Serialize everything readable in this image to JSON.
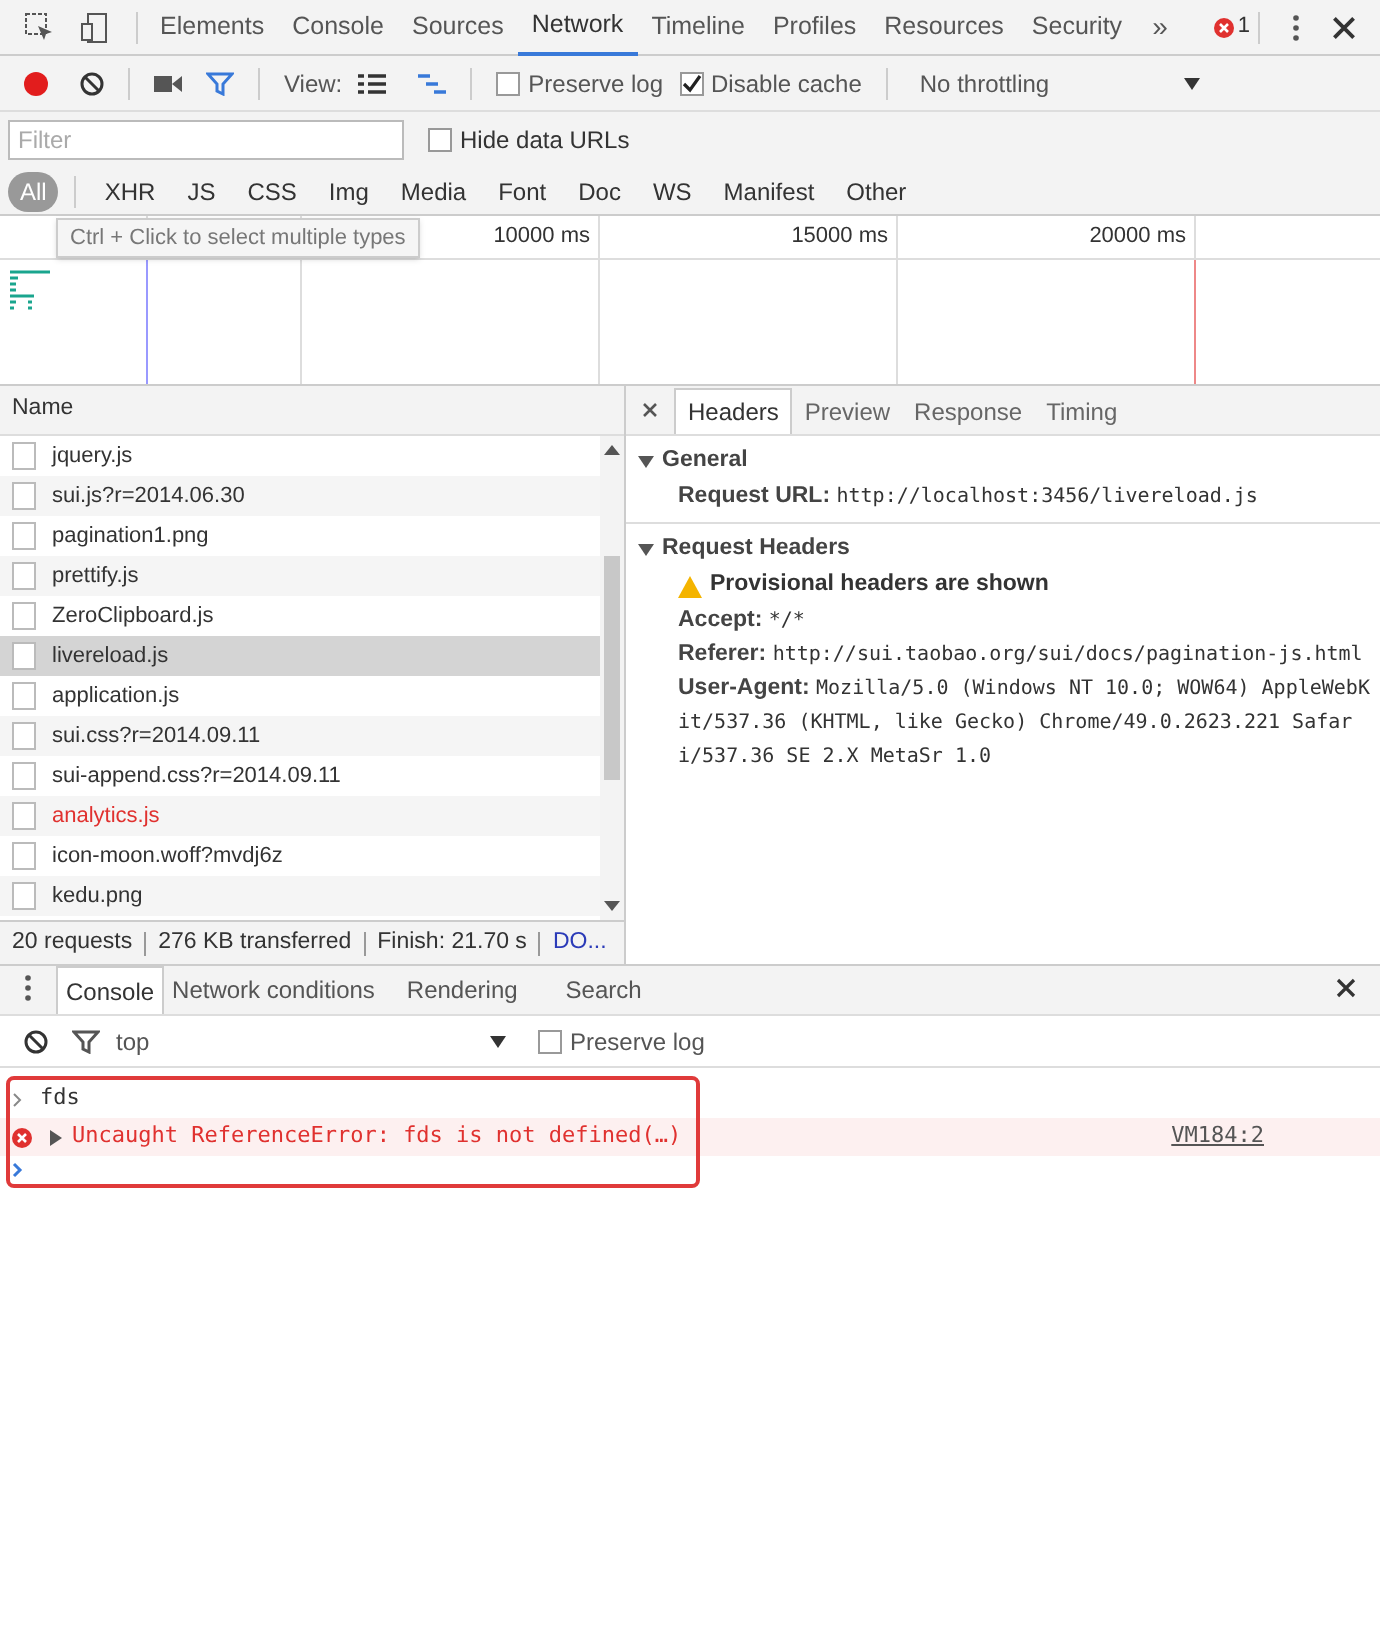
{
  "main_tabs": [
    {
      "label": "Elements",
      "selected": false
    },
    {
      "label": "Console",
      "selected": false
    },
    {
      "label": "Sources",
      "selected": false
    },
    {
      "label": "Network",
      "selected": true
    },
    {
      "label": "Timeline",
      "selected": false
    },
    {
      "label": "Profiles",
      "selected": false
    },
    {
      "label": "Resources",
      "selected": false
    },
    {
      "label": "Security",
      "selected": false
    }
  ],
  "more_tabs": "»",
  "error_count": "1",
  "toolbar": {
    "recording": true,
    "filter_active": true,
    "view_label": "View:",
    "preserve_log": {
      "label": "Preserve log",
      "checked": false
    },
    "disable_cache": {
      "label": "Disable cache",
      "checked": true
    },
    "throttling": "No throttling"
  },
  "filter": {
    "placeholder": "Filter",
    "hide_data_urls": {
      "label": "Hide data URLs",
      "checked": false
    }
  },
  "type_filters": [
    {
      "label": "All",
      "selected": true
    },
    {
      "label": "XHR",
      "selected": false
    },
    {
      "label": "JS",
      "selected": false
    },
    {
      "label": "CSS",
      "selected": false
    },
    {
      "label": "Img",
      "selected": false
    },
    {
      "label": "Media",
      "selected": false
    },
    {
      "label": "Font",
      "selected": false
    },
    {
      "label": "Doc",
      "selected": false
    },
    {
      "label": "WS",
      "selected": false
    },
    {
      "label": "Manifest",
      "selected": false
    },
    {
      "label": "Other",
      "selected": false
    }
  ],
  "timeline": {
    "ticks": [
      "10000 ms",
      "15000 ms",
      "20000 ms"
    ],
    "tooltip": "Ctrl + Click to select multiple types"
  },
  "requests": {
    "column": "Name",
    "rows": [
      {
        "name": "jquery.js",
        "selected": false,
        "failed": false
      },
      {
        "name": "sui.js?r=2014.06.30",
        "selected": false,
        "failed": false
      },
      {
        "name": "pagination1.png",
        "selected": false,
        "failed": false
      },
      {
        "name": "prettify.js",
        "selected": false,
        "failed": false
      },
      {
        "name": "ZeroClipboard.js",
        "selected": false,
        "failed": false
      },
      {
        "name": "livereload.js",
        "selected": true,
        "failed": false
      },
      {
        "name": "application.js",
        "selected": false,
        "failed": false
      },
      {
        "name": "sui.css?r=2014.09.11",
        "selected": false,
        "failed": false
      },
      {
        "name": "sui-append.css?r=2014.09.11",
        "selected": false,
        "failed": false
      },
      {
        "name": "analytics.js",
        "selected": false,
        "failed": true
      },
      {
        "name": "icon-moon.woff?mvdj6z",
        "selected": false,
        "failed": false
      },
      {
        "name": "kedu.png",
        "selected": false,
        "failed": false
      }
    ],
    "summary": [
      "20 requests",
      "276 KB transferred",
      "Finish: 21.70 s"
    ],
    "summary_link": "DO..."
  },
  "details": {
    "tabs": [
      {
        "label": "Headers",
        "selected": true
      },
      {
        "label": "Preview",
        "selected": false
      },
      {
        "label": "Response",
        "selected": false
      },
      {
        "label": "Timing",
        "selected": false
      }
    ],
    "sections": [
      {
        "title": "General",
        "expanded": true,
        "lines": [
          {
            "kind": "header",
            "key": "Request URL:",
            "value": "http://localhost:3456/livereload.js"
          }
        ]
      },
      {
        "title": "Request Headers",
        "expanded": true,
        "lines": [
          {
            "kind": "warning",
            "text": "Provisional headers are shown"
          },
          {
            "kind": "header",
            "key": "Accept:",
            "value": "*/*"
          },
          {
            "kind": "header",
            "key": "Referer:",
            "value": "http://sui.taobao.org/sui/docs/pagination-js.html"
          },
          {
            "kind": "header",
            "key": "User-Agent:",
            "value": "Mozilla/5.0 (Windows NT 10.0; WOW64) AppleWebKit/537.36 (KHTML, like Gecko) Chrome/49.0.2623.221 Safari/537.36 SE 2.X MetaSr 1.0"
          }
        ]
      }
    ]
  },
  "drawer_tabs": [
    {
      "label": "Console",
      "selected": true
    },
    {
      "label": "Network conditions",
      "selected": false
    },
    {
      "label": "Rendering",
      "selected": false
    },
    {
      "label": "Search",
      "selected": false
    }
  ],
  "console": {
    "context": "top",
    "preserve_log": {
      "label": "Preserve log",
      "checked": false
    },
    "messages": [
      {
        "kind": "input",
        "text": "fds"
      },
      {
        "kind": "error",
        "text": "Uncaught ReferenceError: fds is not defined(…)",
        "source": "VM184:2"
      },
      {
        "kind": "prompt"
      }
    ]
  }
}
